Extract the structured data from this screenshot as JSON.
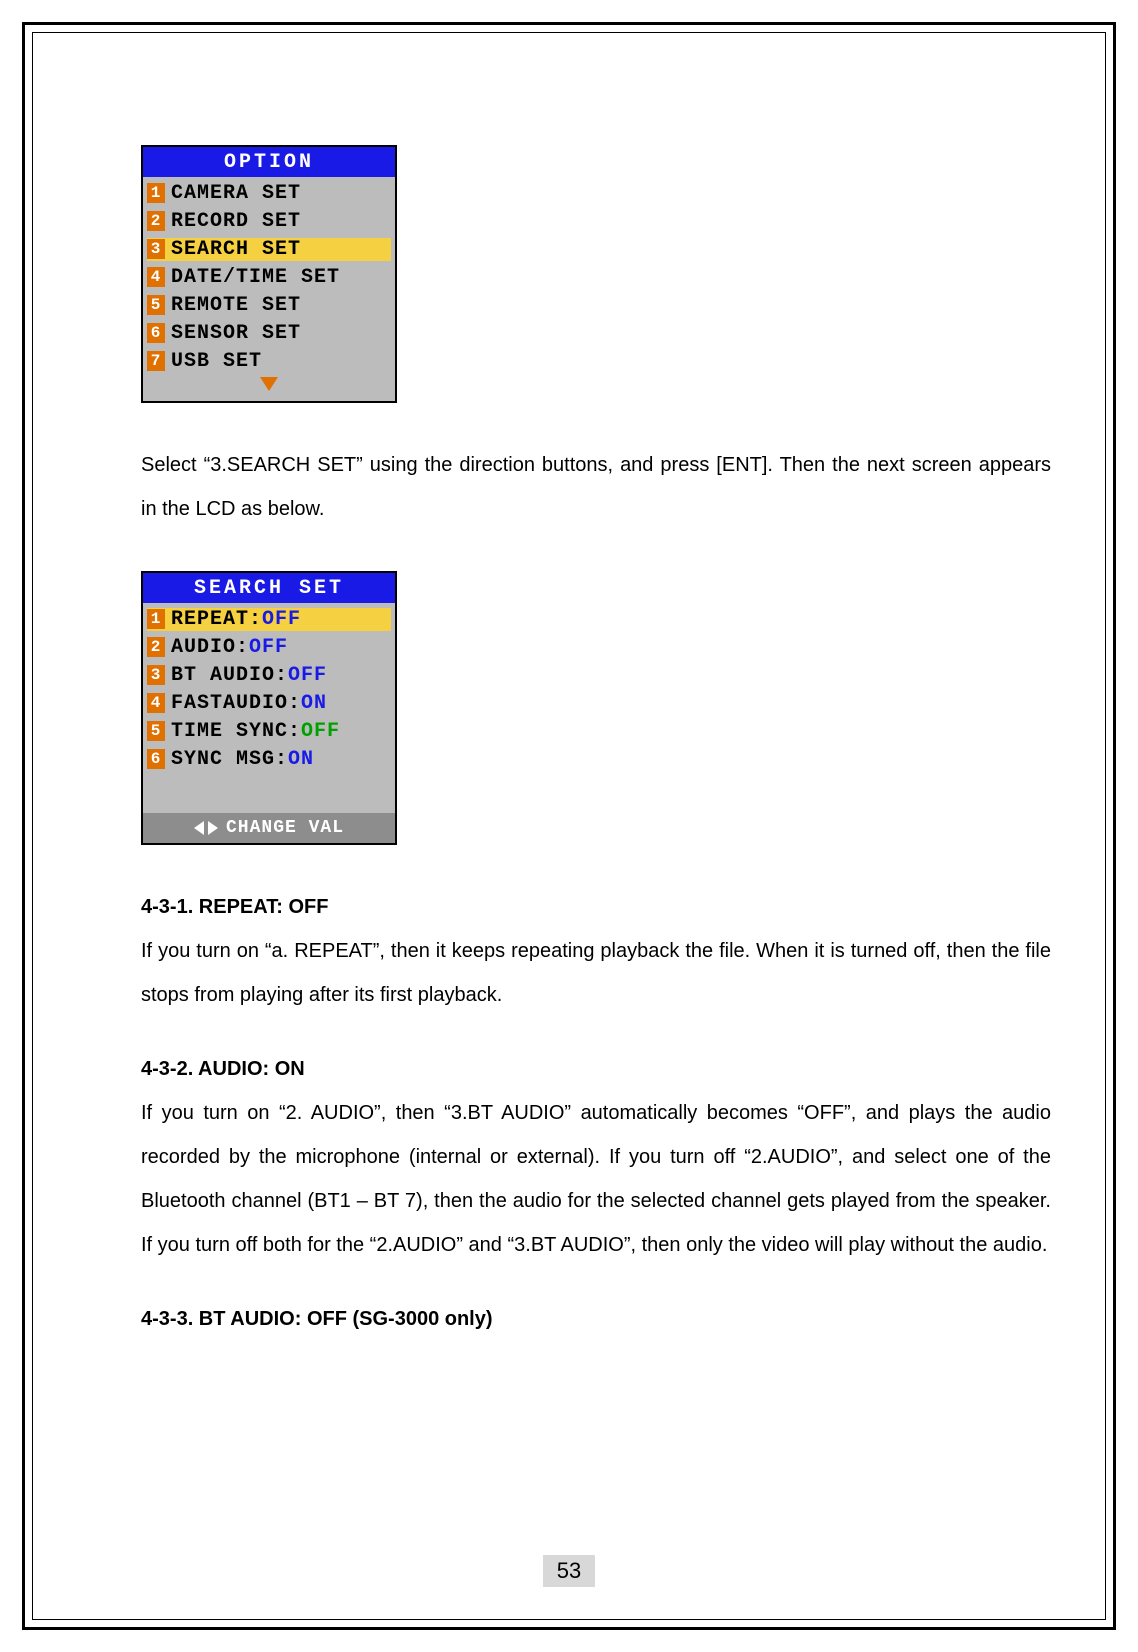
{
  "page_number": "53",
  "option_menu": {
    "title": "OPTION",
    "items": [
      {
        "num": "1",
        "label": "CAMERA SET",
        "highlight": false
      },
      {
        "num": "2",
        "label": "RECORD SET",
        "highlight": false
      },
      {
        "num": "3",
        "label": "SEARCH SET",
        "highlight": true
      },
      {
        "num": "4",
        "label": "DATE/TIME SET",
        "highlight": false
      },
      {
        "num": "5",
        "label": "REMOTE SET",
        "highlight": false
      },
      {
        "num": "6",
        "label": "SENSOR SET",
        "highlight": false
      },
      {
        "num": "7",
        "label": "USB SET",
        "highlight": false
      }
    ]
  },
  "instruction1": "Select “3.SEARCH SET” using the direction buttons, and press [ENT]. Then the next screen appears in the LCD as below.",
  "search_menu": {
    "title": "SEARCH SET",
    "items": [
      {
        "num": "1",
        "label": "REPEAT:",
        "value": "OFF",
        "highlight": true,
        "valclass": "val-off"
      },
      {
        "num": "2",
        "label": "AUDIO:",
        "value": "OFF",
        "highlight": false,
        "valclass": "val-off"
      },
      {
        "num": "3",
        "label": "BT AUDIO:",
        "value": "OFF",
        "highlight": false,
        "valclass": "val-off"
      },
      {
        "num": "4",
        "label": "FASTAUDIO:",
        "value": "ON",
        "highlight": false,
        "valclass": "val-on"
      },
      {
        "num": "5",
        "label": "TIME SYNC:",
        "value": "OFF",
        "highlight": false,
        "valclass": "val-green"
      },
      {
        "num": "6",
        "label": "SYNC MSG:",
        "value": "ON",
        "highlight": false,
        "valclass": "val-on"
      }
    ],
    "footer": "CHANGE VAL"
  },
  "sections": {
    "s1_head": "4-3-1. REPEAT: OFF",
    "s1_body": "If you turn on “a. REPEAT”, then it keeps repeating playback the file. When it is turned off, then the file stops from playing after its first playback.",
    "s2_head": "4-3-2. AUDIO: ON",
    "s2_body": "If you turn on “2. AUDIO”, then “3.BT AUDIO” automatically becomes “OFF”, and plays the audio recorded by the microphone (internal or external). If you turn off “2.AUDIO”, and select one of the Bluetooth channel (BT1 – BT 7), then the audio for the selected channel gets played from the speaker. If you turn off both for the “2.AUDIO” and “3.BT AUDIO”, then only the video will play without the audio.",
    "s3_head": "4-3-3. BT AUDIO: OFF (SG-3000 only)"
  }
}
